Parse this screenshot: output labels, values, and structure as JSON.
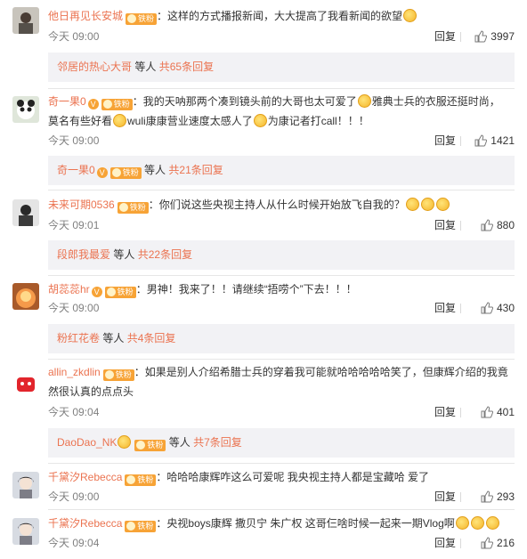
{
  "colors": {
    "username": "#eb7350",
    "badge": "#f7a336",
    "subbox_bg": "#f2f2f5",
    "meta": "#808080"
  },
  "reply_label": "回复",
  "sub_suffix_label": "等人",
  "comments": [
    {
      "user": "他日再见长安城",
      "badge": "铁粉",
      "vip": false,
      "text": "：这样的方式播报新闻，大大提高了我看新闻的欲望",
      "emojis_after": 1,
      "time": "今天 09:00",
      "likes": "3997",
      "sub": {
        "user": "邻居的热心大哥",
        "count": "共65条回复",
        "vip": false
      }
    },
    {
      "user": "奇一果0",
      "badge": "铁粉",
      "vip": true,
      "text_parts": [
        "：我的天呐那两个凑到镜头前的大哥也太可爱了",
        "雅典士兵的衣服还挺时尚，",
        "莫名有些好看",
        "wuli康康营业速度太感人了",
        "为康记者打call！！！"
      ],
      "time": "今天 09:00",
      "likes": "1421",
      "sub": {
        "user": "奇一果0",
        "count": "共21条回复",
        "vip": true
      }
    },
    {
      "user": "未来可期0536",
      "badge": "铁粉",
      "vip": false,
      "text": "：你们说这些央视主持人从什么时候开始放飞自我的？",
      "emojis_after": 3,
      "time": "今天 09:01",
      "likes": "880",
      "sub": {
        "user": "段郎我最爱",
        "count": "共22条回复",
        "vip": false
      }
    },
    {
      "user": "胡蕊蕊hr",
      "badge": "铁粉",
      "vip": true,
      "text": "：男神！我来了！！请继续“捂唠个”下去！！！",
      "emojis_after": 0,
      "time": "今天 09:00",
      "likes": "430",
      "sub": {
        "user": "粉红花卷",
        "count": "共4条回复",
        "vip": false
      }
    },
    {
      "user": "allin_zkdlin",
      "badge": "铁粉",
      "vip": false,
      "text": "：如果是别人介绍希腊士兵的穿着我可能就哈哈哈哈哈笑了，但康辉介绍的我竟然很认真的点点头",
      "emojis_after": 0,
      "time": "今天 09:04",
      "likes": "401",
      "sub": {
        "user": "DaoDao_NK",
        "count": "共7条回复",
        "vip": false
      }
    },
    {
      "user": "千黛汐Rebecca",
      "badge": "铁粉",
      "vip": false,
      "text": "：哈哈哈康辉咋这么可爱呢 我央视主持人都是宝藏哈 爱了",
      "emojis_after": 0,
      "time": "今天 09:00",
      "likes": "293"
    },
    {
      "user": "千黛汐Rebecca",
      "badge": "铁粉",
      "vip": false,
      "text": "：央视boys康辉 撒贝宁 朱广权 这哥仨啥时候一起来一期Vlog啊",
      "emojis_after": 3,
      "time": "今天 09:04",
      "likes": "216"
    }
  ]
}
